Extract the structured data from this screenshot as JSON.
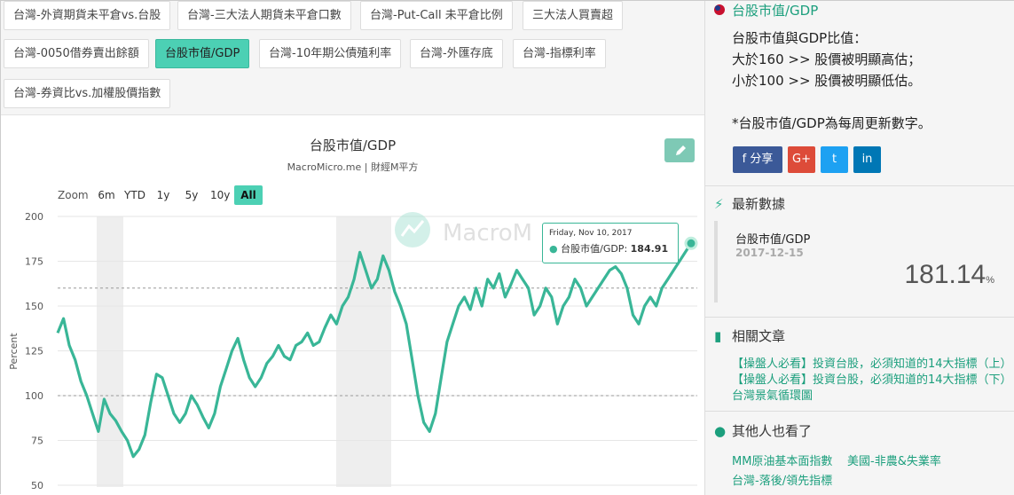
{
  "tags": [
    {
      "label": "台灣-外資期貨未平倉vs.台股",
      "active": false
    },
    {
      "label": "台灣-三大法人期貨未平倉口數",
      "active": false
    },
    {
      "label": "台灣-Put-Call 未平倉比例",
      "active": false
    },
    {
      "label": "三大法人買賣超",
      "active": false
    },
    {
      "label": "台灣-0050借券賣出餘額",
      "active": false
    },
    {
      "label": "台股市值/GDP",
      "active": true
    },
    {
      "label": "台灣-10年期公債殖利率",
      "active": false
    },
    {
      "label": "台灣-外匯存底",
      "active": false
    },
    {
      "label": "台灣-指標利率",
      "active": false
    },
    {
      "label": "台灣-券資比vs.加權股價指數",
      "active": false
    }
  ],
  "chart_header": {
    "title": "台股市值/GDP",
    "subtitle": "MacroMicro.me | 財經M平方",
    "watermark": "MacroM",
    "edit_icon": "pencil-icon"
  },
  "zoom": {
    "label": "Zoom",
    "options": [
      "6m",
      "YTD",
      "1y",
      "5y",
      "10y",
      "All"
    ],
    "active": "All"
  },
  "tooltip": {
    "date": "Friday, Nov 10, 2017",
    "series": "台股市值/GDP:",
    "value": "184.91"
  },
  "chart_data": {
    "type": "line",
    "title": "台股市值/GDP",
    "ylabel": "Percent",
    "ylim": [
      50,
      200
    ],
    "yticks": [
      50,
      75,
      100,
      125,
      150,
      175,
      200
    ],
    "reference_lines": [
      160,
      100
    ],
    "line_color": "#39b697",
    "series": [
      {
        "name": "台股市值/GDP",
        "values": [
          135,
          143,
          128,
          120,
          108,
          100,
          90,
          80,
          98,
          90,
          86,
          80,
          75,
          66,
          70,
          78,
          96,
          112,
          110,
          100,
          90,
          85,
          90,
          100,
          95,
          88,
          82,
          90,
          105,
          115,
          125,
          132,
          120,
          110,
          105,
          110,
          118,
          122,
          128,
          122,
          120,
          128,
          130,
          135,
          128,
          130,
          138,
          145,
          140,
          150,
          155,
          165,
          180,
          170,
          160,
          165,
          178,
          170,
          158,
          150,
          140,
          120,
          100,
          85,
          80,
          90,
          110,
          130,
          140,
          150,
          155,
          148,
          160,
          150,
          165,
          160,
          168,
          155,
          162,
          170,
          165,
          160,
          145,
          150,
          160,
          155,
          140,
          150,
          155,
          165,
          160,
          150,
          155,
          160,
          165,
          170,
          172,
          168,
          160,
          145,
          140,
          150,
          155,
          150,
          160,
          165,
          170,
          175,
          180,
          185
        ]
      }
    ]
  },
  "sidebar": {
    "section_title": "台股市值/GDP",
    "description": "台股市值與GDP比值：\n大於160 >> 股價被明顯高估；\n小於100 >> 股價被明顯低估。\n\n*台股市值/GDP為每周更新數字。",
    "share_buttons": [
      {
        "label": "分享",
        "icon": "facebook-icon",
        "color": "#3b5998"
      },
      {
        "label": "G+",
        "icon": "google-plus-icon",
        "color": "#dd4b39"
      },
      {
        "label": "t",
        "icon": "twitter-icon",
        "color": "#1da1f2"
      },
      {
        "label": "in",
        "icon": "linkedin-icon",
        "color": "#0077b5"
      }
    ],
    "latest_title": "最新數據",
    "latest_name": "台股市值/GDP",
    "latest_date": "2017-12-15",
    "latest_value": "181.14",
    "latest_unit": "%",
    "articles_title": "相關文章",
    "articles": [
      "【操盤人必看】投資台股，必須知道的14大指標（上）",
      "【操盤人必看】投資台股，必須知道的14大指標（下）",
      "台灣景氣循環圖"
    ],
    "others_title": "其他人也看了",
    "others": [
      "MM原油基本面指數",
      "美國-非農&失業率",
      "台灣-落後/領先指標"
    ]
  }
}
